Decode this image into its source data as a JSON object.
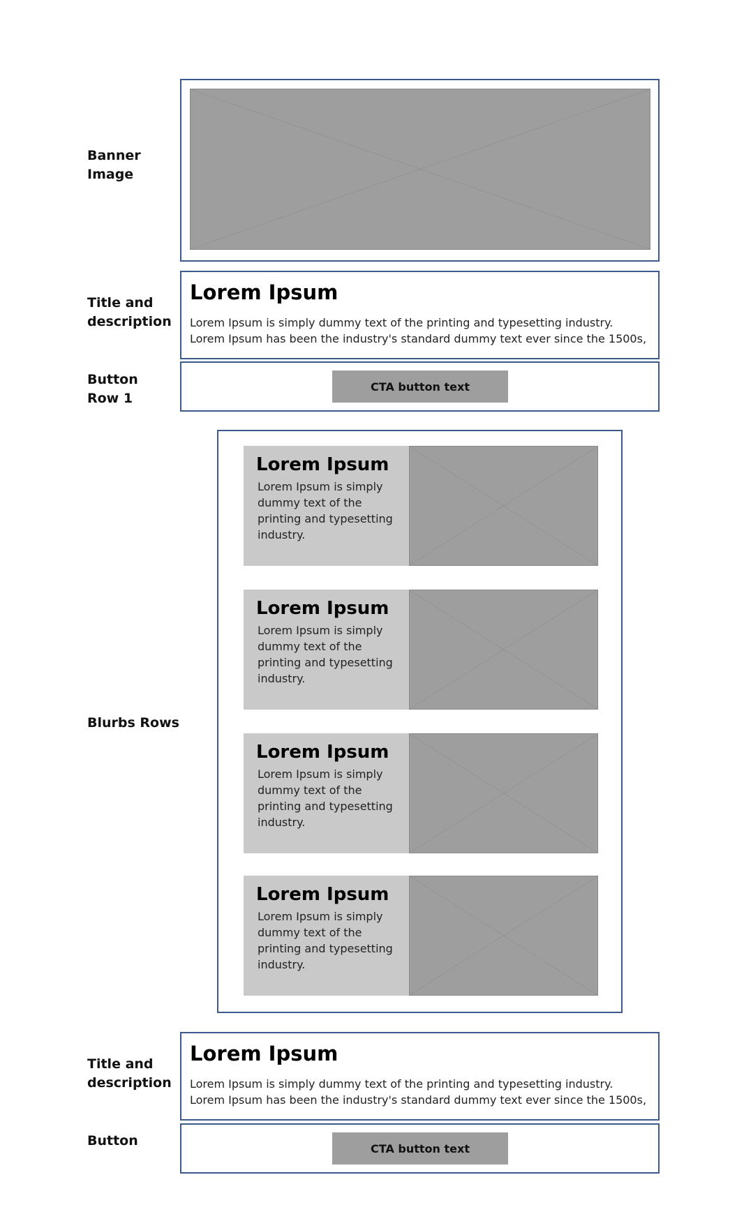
{
  "labels": {
    "banner": "Banner\nImage",
    "title_desc_1": "Title and\ndescription",
    "button_row_1": "Button\nRow 1",
    "blurbs_rows": "Blurbs Rows",
    "title_desc_2": "Title and\ndescription",
    "button_2": "Button"
  },
  "section_1": {
    "title": "Lorem Ipsum",
    "description": "Lorem Ipsum is simply dummy text of the printing and typesetting industry. Lorem Ipsum has been the industry's standard dummy text ever since the 1500s,"
  },
  "button_row_1": {
    "label": "CTA button text"
  },
  "blurbs": [
    {
      "title": "Lorem Ipsum",
      "description": "Lorem Ipsum is simply dummy text of the printing and typesetting industry."
    },
    {
      "title": "Lorem Ipsum",
      "description": "Lorem Ipsum is simply dummy text of the printing and typesetting industry."
    },
    {
      "title": "Lorem Ipsum",
      "description": "Lorem Ipsum is simply dummy text of the printing and typesetting industry."
    },
    {
      "title": "Lorem Ipsum",
      "description": "Lorem Ipsum is simply dummy text of the printing and typesetting industry."
    }
  ],
  "section_2": {
    "title": "Lorem Ipsum",
    "description": "Lorem Ipsum is simply dummy text of the printing and typesetting industry. Lorem Ipsum has been the industry's standard dummy text ever since the 1500s,"
  },
  "button_2": {
    "label": "CTA button text"
  },
  "colors": {
    "frame_border": "#3c5a8c",
    "placeholder_fill": "#9e9e9e",
    "blurb_fill": "#c9c9c9"
  }
}
